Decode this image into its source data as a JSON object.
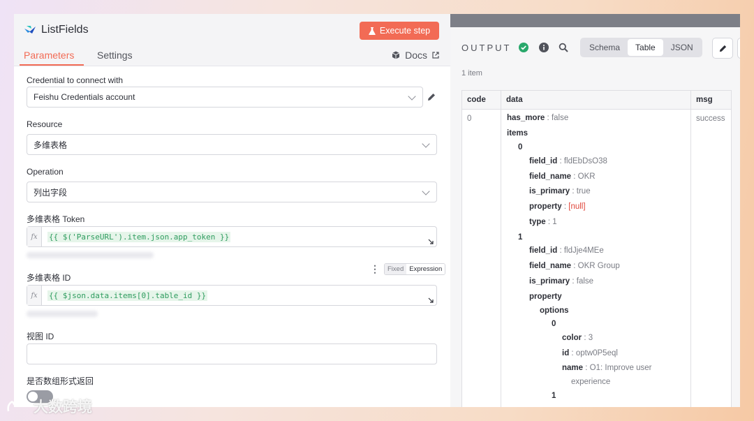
{
  "node": {
    "title": "ListFields",
    "execute_label": "Execute step"
  },
  "tabs": {
    "parameters": "Parameters",
    "settings": "Settings",
    "docs": "Docs"
  },
  "fields": {
    "credential": {
      "label": "Credential to connect with",
      "value": "Feishu Credentials account"
    },
    "resource": {
      "label": "Resource",
      "value": "多维表格"
    },
    "operation": {
      "label": "Operation",
      "value": "列出字段"
    },
    "token": {
      "label": "多维表格 Token",
      "value": "{{ $('ParseURL').item.json.app_token }}"
    },
    "table_id": {
      "label": "多维表格 ID",
      "value": "{{ $json.data.items[0].table_id }}",
      "fixed": "Fixed",
      "expression": "Expression"
    },
    "view_id": {
      "label": "视图 ID",
      "value": ""
    },
    "as_array": {
      "label": "是否数组形式返回"
    }
  },
  "output": {
    "title": "OUTPUT",
    "views": [
      "Schema",
      "Table",
      "JSON"
    ],
    "active_view": "Table",
    "count": "1 item",
    "columns": [
      "code",
      "data",
      "msg"
    ],
    "code": "0",
    "msg": "success",
    "tree": [
      {
        "key": "has_more",
        "sep": " : ",
        "val": "false"
      },
      {
        "key": "items"
      },
      {
        "key": "0"
      },
      {
        "key": "field_id",
        "sep": " : ",
        "val": "fldEbDsO38"
      },
      {
        "key": "field_name",
        "sep": " : ",
        "val": "OKR"
      },
      {
        "key": "is_primary",
        "sep": " : ",
        "val": "true"
      },
      {
        "key": "property",
        "sep": " : ",
        "val": "[null]",
        "null": true
      },
      {
        "key": "type",
        "sep": " : ",
        "val": "1"
      },
      {
        "key": "1"
      },
      {
        "key": "field_id",
        "sep": " : ",
        "val": "fldJje4MEe"
      },
      {
        "key": "field_name",
        "sep": " : ",
        "val": "OKR Group"
      },
      {
        "key": "is_primary",
        "sep": " : ",
        "val": "false"
      },
      {
        "key": "property"
      },
      {
        "key": "options"
      },
      {
        "key": "0"
      },
      {
        "key": "color",
        "sep": " : ",
        "val": "3"
      },
      {
        "key": "id",
        "sep": " : ",
        "val": "optw0P5eql"
      },
      {
        "key": "name",
        "sep": " : ",
        "val": "O1: Improve user"
      },
      {
        "val": "experience"
      },
      {
        "key": "1"
      }
    ]
  },
  "watermark": "大数跨境",
  "colors": {
    "accent": "#f26b55",
    "success": "#29a86b",
    "null": "#e0453a"
  }
}
